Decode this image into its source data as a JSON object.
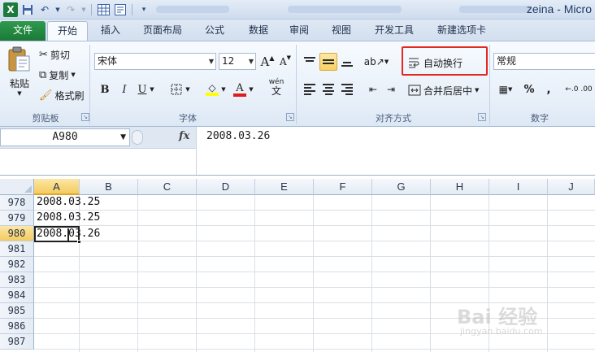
{
  "titlebar": {
    "title": "zeina - Micro",
    "qat_icons": [
      "excel-icon",
      "save-icon",
      "undo-icon",
      "redo-icon",
      "table-icon",
      "form-icon"
    ]
  },
  "tabs": [
    {
      "label": "文件"
    },
    {
      "label": "开始"
    },
    {
      "label": "插入"
    },
    {
      "label": "页面布局"
    },
    {
      "label": "公式"
    },
    {
      "label": "数据"
    },
    {
      "label": "审阅"
    },
    {
      "label": "视图"
    },
    {
      "label": "开发工具"
    },
    {
      "label": "新建选项卡"
    }
  ],
  "clipboard": {
    "paste": "粘贴",
    "cut": "剪切",
    "copy": "复制",
    "format_painter": "格式刷",
    "group": "剪贴板"
  },
  "font": {
    "name": "宋体",
    "size": "12",
    "bold": "B",
    "italic": "I",
    "underline": "U",
    "phonetic": "wén",
    "group": "字体"
  },
  "alignment": {
    "wrap_text": "自动换行",
    "merge_center": "合并后居中",
    "group": "对齐方式"
  },
  "number": {
    "format": "常规",
    "percent": "%",
    "comma": ",",
    "group": "数字"
  },
  "formula_bar": {
    "name_box": "A980",
    "fx": "fx",
    "value": "2008.03.26"
  },
  "grid": {
    "columns": [
      "A",
      "B",
      "C",
      "D",
      "E",
      "F",
      "G",
      "H",
      "I",
      "J"
    ],
    "rows": [
      {
        "number": "978",
        "a": "2008.03.25"
      },
      {
        "number": "979",
        "a": "2008.03.25"
      },
      {
        "number": "980",
        "a": "2008.03.26"
      },
      {
        "number": "981",
        "a": ""
      },
      {
        "number": "982",
        "a": ""
      },
      {
        "number": "983",
        "a": ""
      },
      {
        "number": "984",
        "a": ""
      },
      {
        "number": "985",
        "a": ""
      },
      {
        "number": "986",
        "a": ""
      },
      {
        "number": "987",
        "a": ""
      }
    ]
  },
  "watermark": {
    "text": "Bai 经验",
    "sub": "jingyan.baidu.com"
  }
}
